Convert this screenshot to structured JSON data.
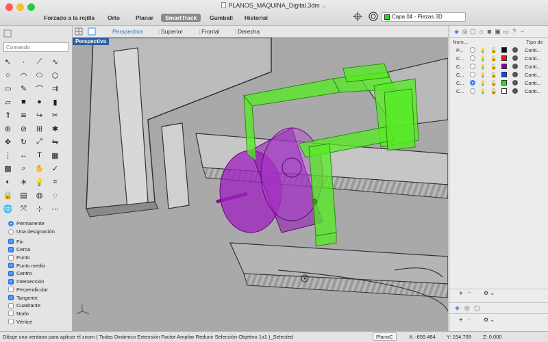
{
  "window": {
    "title": "PLANOS_MÁQUINA_Digital.3dm",
    "traffic_colors": [
      "#fc5f57",
      "#fdbc2e",
      "#2ac840"
    ]
  },
  "toolbar": {
    "items": [
      "Forzado a la rejilla",
      "Orto",
      "Planar",
      "SmartTrack",
      "Gumball",
      "Historial"
    ],
    "active": "SmartTrack",
    "current_layer": "Capa 04 - Piezas 3D",
    "current_layer_color": "#22dd22"
  },
  "left_panel": {
    "command_placeholder": "Comando",
    "tool_icons": [
      "pointer-icon",
      "point-icon",
      "polyline-icon",
      "curve-icon",
      "circle-icon",
      "arc-icon",
      "ellipse-icon",
      "polygon-icon",
      "rectangle-icon",
      "freeform-icon",
      "fillet-icon",
      "offset-icon",
      "surface-icon",
      "box-icon",
      "sphere-icon",
      "cylinder-icon",
      "extrude-icon",
      "loft-icon",
      "sweep-icon",
      "trim-icon",
      "boolean-icon",
      "split-icon",
      "join-icon",
      "explode-icon",
      "move-icon",
      "rotate-icon",
      "scale-icon",
      "mirror-icon",
      "array-icon",
      "dimension-icon",
      "text-icon",
      "hatch-icon",
      "grid-icon",
      "zoom-icon",
      "pan-icon",
      "check-icon",
      "analyze-icon",
      "render-icon",
      "light-icon",
      "camera-icon",
      "lock-icon",
      "layer-icon",
      "material-icon",
      "env-icon",
      "globe-icon",
      "transform-icon",
      "snap-icon",
      "misc-icon"
    ],
    "osnap_mode": [
      {
        "label": "Permanente",
        "on": true
      },
      {
        "label": "Una designación",
        "on": false
      }
    ],
    "osnaps": [
      {
        "label": "Fin",
        "on": true
      },
      {
        "label": "Cerca",
        "on": true
      },
      {
        "label": "Punto",
        "on": false
      },
      {
        "label": "Punto medio",
        "on": true
      },
      {
        "label": "Centro",
        "on": true
      },
      {
        "label": "Intersección",
        "on": true
      },
      {
        "label": "Perpendicular",
        "on": false
      },
      {
        "label": "Tangente",
        "on": true
      },
      {
        "label": "Cuadrante",
        "on": false
      },
      {
        "label": "Nodo",
        "on": false
      },
      {
        "label": "Vértice",
        "on": false
      }
    ]
  },
  "view_tabs": {
    "tabs": [
      "Perspectiva",
      "Superior",
      "Frontal",
      "Derecha"
    ],
    "active": "Perspectiva"
  },
  "viewport": {
    "label": "Perspectiva",
    "background": "#a8a8a8",
    "selected_green": "#55ee22",
    "selected_purple": "#a020c0"
  },
  "right_panel": {
    "icons": [
      "layers-icon",
      "display-icon",
      "object-icon",
      "model-icon",
      "camera-icon",
      "render-icon",
      "monitor-icon",
      "help-icon",
      "minus-icon"
    ],
    "columns": [
      "Nom...",
      "Tipo de"
    ],
    "layers": [
      {
        "name": "P...",
        "color": "#111111",
        "type": "Conti..."
      },
      {
        "name": "C...",
        "color": "#ff1111",
        "type": "Conti..."
      },
      {
        "name": "C...",
        "color": "#8800aa",
        "type": "Conti..."
      },
      {
        "name": "C...",
        "color": "#1144ff",
        "type": "Conti..."
      },
      {
        "name": "C...",
        "color": "#22dd22",
        "type": "Conti..."
      },
      {
        "name": "C...",
        "color": "#ffffff",
        "type": "Conti..."
      }
    ]
  },
  "status": {
    "prompt": "Dibuje una ventana para aplicar el zoom ( Todas Dinámico Extensión Factor Ampliar Reducir Selección Objetivo 1x1 )_Selected",
    "plane": "PlanoC",
    "x": "X: -659.484",
    "y": "Y: 194.709",
    "z": "Z: 0.000"
  }
}
